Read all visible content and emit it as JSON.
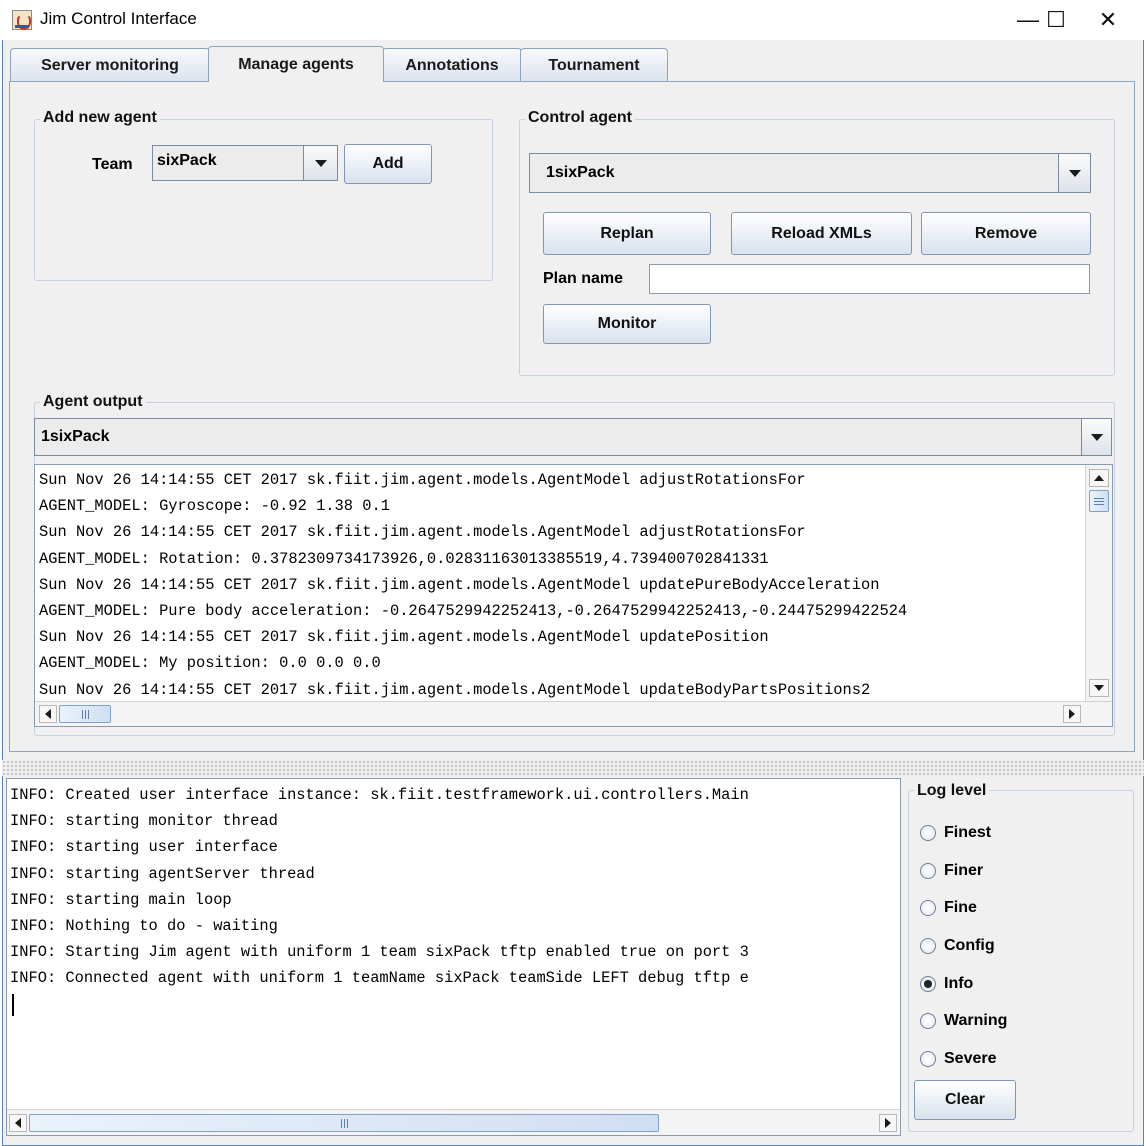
{
  "window": {
    "title": "Jim Control Interface",
    "minimize": "—",
    "maximize": "☐",
    "close": "✕"
  },
  "tabs": [
    {
      "label": "Server monitoring"
    },
    {
      "label": "Manage agents"
    },
    {
      "label": "Annotations"
    },
    {
      "label": "Tournament"
    }
  ],
  "add_agent": {
    "title": "Add new agent",
    "team_label": "Team",
    "team_value": "sixPack",
    "add_label": "Add"
  },
  "control_agent": {
    "title": "Control agent",
    "agent_value": "1sixPack",
    "replan_label": "Replan",
    "reload_label": "Reload XMLs",
    "remove_label": "Remove",
    "plan_name_label": "Plan name",
    "plan_name_value": "",
    "monitor_label": "Monitor"
  },
  "agent_output": {
    "title": "Agent output",
    "agent_value": "1sixPack",
    "lines": [
      "Sun Nov 26 14:14:55 CET 2017 sk.fiit.jim.agent.models.AgentModel adjustRotationsFor",
      "AGENT_MODEL: Gyroscope: -0.92 1.38 0.1",
      "Sun Nov 26 14:14:55 CET 2017 sk.fiit.jim.agent.models.AgentModel adjustRotationsFor",
      "AGENT_MODEL: Rotation: 0.3782309734173926,0.02831163013385519,4.739400702841331",
      "Sun Nov 26 14:14:55 CET 2017 sk.fiit.jim.agent.models.AgentModel updatePureBodyAcceleration",
      "AGENT_MODEL: Pure body acceleration: -0.2647529942252413,-0.2647529942252413,-0.24475299422524",
      "Sun Nov 26 14:14:55 CET 2017 sk.fiit.jim.agent.models.AgentModel updatePosition",
      "AGENT_MODEL: My position: 0.0 0.0 0.0",
      "Sun Nov 26 14:14:55 CET 2017 sk.fiit.jim.agent.models.AgentModel updateBodyPartsPositions2"
    ]
  },
  "log": {
    "lines": [
      "INFO: Created user interface instance: sk.fiit.testframework.ui.controllers.Main",
      "INFO: starting monitor thread",
      "INFO: starting user interface",
      "INFO: starting agentServer thread",
      "INFO: starting main loop",
      "INFO: Nothing to do - waiting",
      "INFO: Starting Jim agent with uniform 1 team sixPack tftp enabled true on port 3",
      "INFO: Connected agent with uniform 1 teamName sixPack teamSide LEFT debug tftp e"
    ]
  },
  "log_level": {
    "title": "Log level",
    "options": [
      {
        "label": "Finest",
        "selected": false
      },
      {
        "label": "Finer",
        "selected": false
      },
      {
        "label": "Fine",
        "selected": false
      },
      {
        "label": "Config",
        "selected": false
      },
      {
        "label": "Info",
        "selected": true
      },
      {
        "label": "Warning",
        "selected": false
      },
      {
        "label": "Severe",
        "selected": false
      }
    ],
    "clear_label": "Clear"
  }
}
